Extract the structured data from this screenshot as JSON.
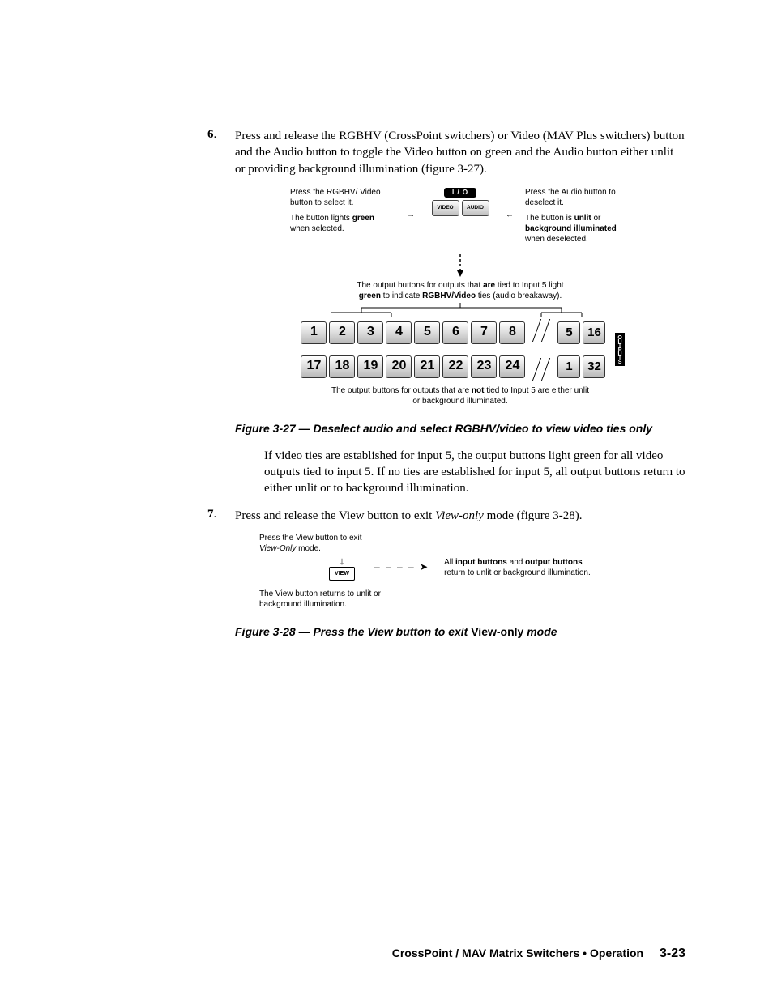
{
  "step6": {
    "num": "6",
    "text_prefix": ".",
    "body": "Press and release the RGBHV (CrossPoint switchers) or Video (MAV Plus switchers) button and the Audio button to toggle the Video button on green and the Audio button either unlit or providing background illumination (figure 3-27)."
  },
  "fig327_top": {
    "left1": "Press the RGBHV/ Video button to select it.",
    "left2a": "The button lights ",
    "left2b": "green",
    "left2c": " when selected.",
    "io_label": "I / O",
    "btn_video": "VIDEO",
    "btn_audio": "AUDIO",
    "right1": "Press the Audio button to deselect it.",
    "right2a": "The button is ",
    "right2b": "unlit",
    "right2c": " or ",
    "right2d": "background illuminated",
    "right2e": " when deselected."
  },
  "fig327_note_top_a": "The output buttons for outputs that ",
  "fig327_note_top_b": "are",
  "fig327_note_top_c": " tied to Input 5 light ",
  "fig327_note_top_d": "green",
  "fig327_note_top_e": " to indicate ",
  "fig327_note_top_f": "RGBHV/Video",
  "fig327_note_top_g": " ties (audio breakaway).",
  "outputs_row1": [
    "1",
    "2",
    "3",
    "4",
    "5",
    "6",
    "7",
    "8"
  ],
  "outputs_row1b": [
    "5",
    "16"
  ],
  "outputs_row2": [
    "17",
    "18",
    "19",
    "20",
    "21",
    "22",
    "23",
    "24"
  ],
  "outputs_row2b": [
    "1",
    "32"
  ],
  "outputs_vlabel": "OUTPUTS",
  "fig327_note_bottom_a": "The output buttons for outputs that are ",
  "fig327_note_bottom_b": "not",
  "fig327_note_bottom_c": " tied to Input 5 are either unlit or background illuminated.",
  "fig327_caption": "Figure 3-27 — Deselect audio and select RGBHV/video to view video ties only",
  "para_after_327": "If video ties are established for input 5, the output buttons light green for all video outputs tied to input 5.  If no ties are established for input 5, all output buttons return to either unlit or to background illumination.",
  "step7": {
    "num": "7",
    "body_a": "Press and release the View button to exit ",
    "body_b": "View-only",
    "body_c": " mode (figure 3-28)."
  },
  "fig328": {
    "top_a": "Press the View button to exit ",
    "top_b": "View-Only",
    "top_c": " mode.",
    "view": "VIEW",
    "right_a": "All ",
    "right_b": "input buttons",
    "right_c": " and ",
    "right_d": "output buttons",
    "right_e": " return to unlit or background illumination.",
    "bottom": "The View button returns to unlit or background illumination."
  },
  "fig328_caption_a": "Figure 3-28 — Press the View button to exit ",
  "fig328_caption_b": "View-only",
  "fig328_caption_c": " mode",
  "footer": {
    "title": "CrossPoint / MAV Matrix Switchers • Operation",
    "page": "3-23"
  }
}
